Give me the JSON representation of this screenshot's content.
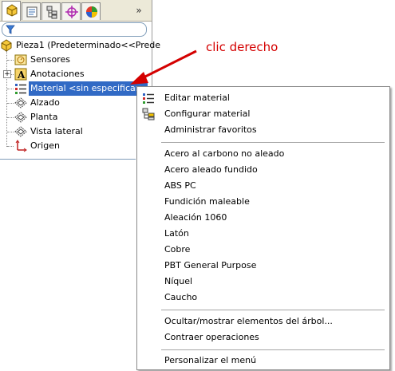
{
  "tree": {
    "root_label": "Pieza1  (Predeterminado<<Prede",
    "items": [
      {
        "label": "Sensores",
        "icon": "sensor-icon"
      },
      {
        "label": "Anotaciones",
        "icon": "annotation-icon"
      },
      {
        "label": "Material <sin especificar>",
        "icon": "material-icon"
      },
      {
        "label": "Alzado",
        "icon": "plane-icon"
      },
      {
        "label": "Planta",
        "icon": "plane-icon"
      },
      {
        "label": "Vista lateral",
        "icon": "plane-icon"
      },
      {
        "label": "Origen",
        "icon": "origin-icon"
      }
    ],
    "expander": "+"
  },
  "tabs": {
    "more": "»"
  },
  "annotation": {
    "text": "clic derecho",
    "color": "#d40000"
  },
  "context_menu": {
    "group1": [
      "Editar material",
      "Configurar material",
      "Administrar favoritos"
    ],
    "group2": [
      "Acero al carbono no aleado",
      "Acero aleado fundido",
      "ABS PC",
      "Fundición maleable",
      "Aleación 1060",
      "Latón",
      "Cobre",
      "PBT General Purpose",
      "Níquel",
      "Caucho"
    ],
    "group3": [
      "Ocultar/mostrar elementos del árbol...",
      "Contraer operaciones"
    ],
    "group4": [
      "Personalizar el menú"
    ]
  },
  "colors": {
    "selection": "#316ac5",
    "accent_red": "#d40000"
  }
}
